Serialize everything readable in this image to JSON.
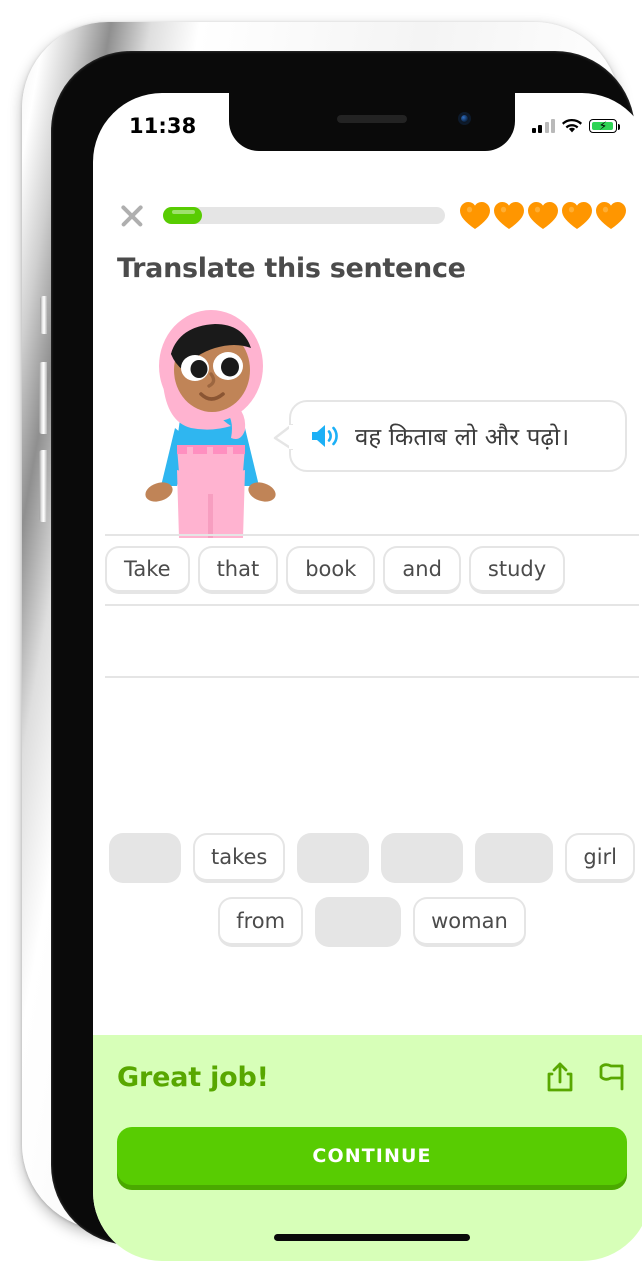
{
  "device": {
    "type": "iphone-x-silver",
    "home_indicator": true
  },
  "status_bar": {
    "time": "11:38",
    "signal_icon": "cellular-signal-icon",
    "signal_bars_filled": 2,
    "signal_bars_total": 4,
    "wifi_icon": "wifi-icon",
    "battery_icon": "battery-charging-icon",
    "battery_charging": true,
    "battery_color": "#2fd455"
  },
  "lesson_header": {
    "close_icon": "close-x-icon",
    "progress_percent": 14,
    "progress_fill_color": "#58cc02",
    "progress_track_color": "#e5e5e5",
    "hearts_total": 5,
    "hearts_remaining": 5,
    "heart_color": "#ff9600"
  },
  "prompt": {
    "title": "Translate this sentence",
    "title_color": "#4b4b4b"
  },
  "challenge": {
    "character_name": "zari-character",
    "speaker_icon": "speaker-audio-icon",
    "speaker_icon_color": "#1cb0f6",
    "source_sentence": "वह किताब लो और पढ़ो।",
    "source_language": "Hindi"
  },
  "answer": {
    "lines": [
      {
        "tiles": [
          "Take",
          "that",
          "book",
          "and",
          "study"
        ]
      },
      {
        "tiles": []
      },
      {
        "tiles": []
      }
    ]
  },
  "word_bank": {
    "rows": [
      [
        {
          "label": "",
          "used": true
        },
        {
          "label": "takes",
          "used": false
        },
        {
          "label": "",
          "used": true
        },
        {
          "label": "",
          "used": true
        },
        {
          "label": "",
          "used": true
        },
        {
          "label": "girl",
          "used": false
        }
      ],
      [
        {
          "label": "from",
          "used": false
        },
        {
          "label": "",
          "used": true
        },
        {
          "label": "woman",
          "used": false
        }
      ]
    ]
  },
  "footer": {
    "feedback_title": "Great job!",
    "feedback_color": "#58a700",
    "background_color": "#d7ffb8",
    "share_icon": "share-icon",
    "flag_icon": "report-flag-icon",
    "continue_label": "CONTINUE",
    "continue_color": "#58cc02"
  }
}
